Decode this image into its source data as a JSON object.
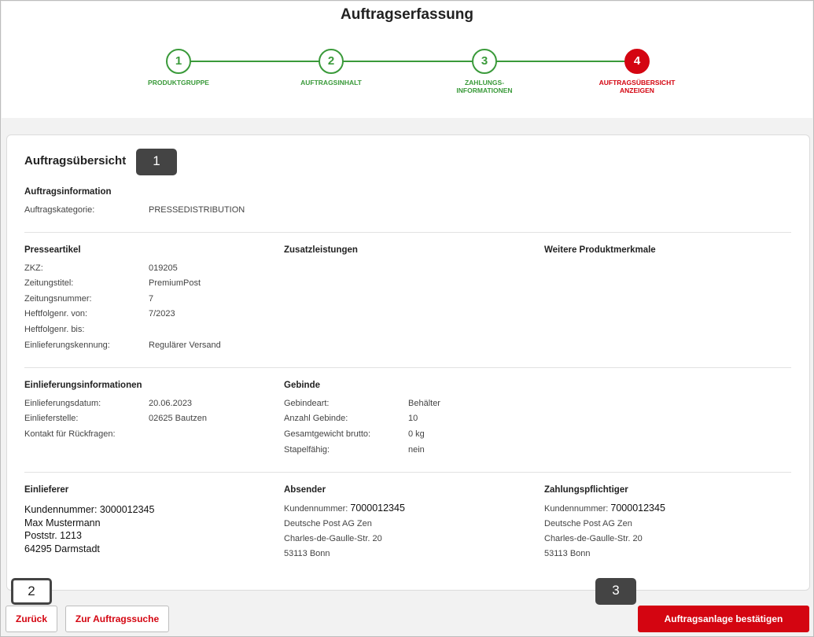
{
  "page": {
    "title": "Auftragserfassung"
  },
  "stepper": {
    "steps": [
      {
        "number": "1",
        "label": "PRODUKTGRUPPE"
      },
      {
        "number": "2",
        "label": "AUFTRAGSINHALT"
      },
      {
        "number": "3",
        "label": "ZAHLUNGS-\nINFORMATIONEN"
      },
      {
        "number": "4",
        "label": "AUFTRAGSÜBERSICHT\nANZEIGEN"
      }
    ]
  },
  "markers": {
    "m1": "1",
    "m2": "2",
    "m3": "3"
  },
  "overview": {
    "title": "Auftragsübersicht",
    "auftragsinformation": {
      "title": "Auftragsinformation",
      "rows": [
        {
          "k": "Auftragskategorie:",
          "v": "PRESSEDISTRIBUTION"
        }
      ]
    },
    "presseartikel": {
      "title": "Presseartikel",
      "rows": [
        {
          "k": "ZKZ:",
          "v": "019205"
        },
        {
          "k": "Zeitungstitel:",
          "v": "PremiumPost"
        },
        {
          "k": "Zeitungsnummer:",
          "v": "7"
        },
        {
          "k": "Heftfolgenr. von:",
          "v": "7/2023"
        },
        {
          "k": "Heftfolgenr. bis:",
          "v": ""
        },
        {
          "k": "Einlieferungskennung:",
          "v": "Regulärer Versand"
        }
      ]
    },
    "zusatzleistungen": {
      "title": "Zusatzleistungen"
    },
    "weitere": {
      "title": "Weitere Produktmerkmale"
    },
    "einlieferungsinformationen": {
      "title": "Einlieferungsinformationen",
      "rows": [
        {
          "k": "Einlieferungsdatum:",
          "v": "20.06.2023"
        },
        {
          "k": "Einlieferstelle:",
          "v": "02625 Bautzen"
        },
        {
          "k": "Kontakt für Rückfragen:",
          "v": ""
        }
      ]
    },
    "gebinde": {
      "title": "Gebinde",
      "rows": [
        {
          "k": "Gebindeart:",
          "v": "Behälter"
        },
        {
          "k": "Anzahl Gebinde:",
          "v": "10"
        },
        {
          "k": "Gesamtgewicht brutto:",
          "v": "0 kg"
        },
        {
          "k": "Stapelfähig:",
          "v": "nein"
        }
      ]
    },
    "einlieferer": {
      "title": "Einlieferer",
      "kunden_label": "Kundennummer:",
      "kunden_nr": "3000012345",
      "name": "Max Mustermann",
      "street": "Poststr. 1213",
      "city": "64295 Darmstadt"
    },
    "absender": {
      "title": "Absender",
      "kunden_label": "Kundennummer:",
      "kunden_nr": "7000012345",
      "name": "Deutsche Post AG Zen",
      "street": "Charles-de-Gaulle-Str. 20",
      "city": "53113 Bonn"
    },
    "zahlungspflichtiger": {
      "title": "Zahlungspflichtiger",
      "kunden_label": "Kundennummer:",
      "kunden_nr": "7000012345",
      "name": "Deutsche Post AG Zen",
      "street": "Charles-de-Gaulle-Str. 20",
      "city": "53113 Bonn"
    }
  },
  "footer": {
    "back_label": "Zurück",
    "search_label": "Zur Auftragssuche",
    "confirm_label": "Auftragsanlage bestätigen"
  },
  "colors": {
    "accent": "#d40511",
    "success": "#3a9a3a"
  }
}
